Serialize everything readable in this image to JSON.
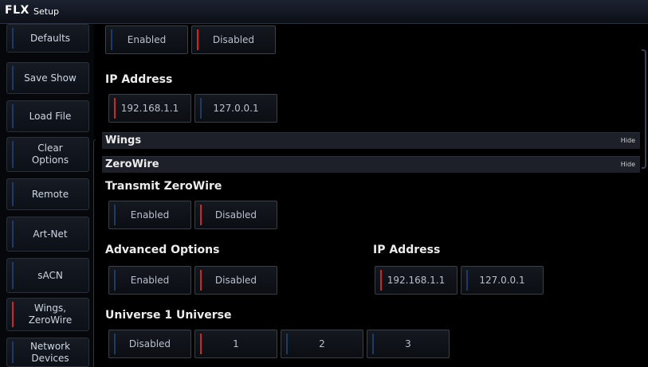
{
  "titlebar": {
    "logo": "FLX",
    "title": "Setup"
  },
  "sidebar": {
    "items": [
      {
        "label": "Defaults",
        "active": false
      },
      {
        "label": "Save Show",
        "active": false
      },
      {
        "label": "Load File",
        "active": false
      },
      {
        "label": "Clear Options",
        "active": false
      },
      {
        "label": "Remote",
        "active": false
      },
      {
        "label": "Art-Net",
        "active": false
      },
      {
        "label": "sACN",
        "active": false
      },
      {
        "label": "Wings, ZeroWire",
        "active": true
      },
      {
        "label": "Network Devices",
        "active": false
      }
    ]
  },
  "main": {
    "top_toggle": {
      "enabled": "Enabled",
      "disabled": "Disabled",
      "selected": "disabled"
    },
    "ip_address": {
      "label": "IP Address",
      "options": [
        "192.168.1.1",
        "127.0.0.1"
      ],
      "selected": "192.168.1.1"
    },
    "wings_header": {
      "title": "Wings",
      "hide": "Hide"
    },
    "zerowire_header": {
      "title": "ZeroWire",
      "hide": "Hide"
    },
    "transmit_zerowire": {
      "label": "Transmit ZeroWire",
      "enabled": "Enabled",
      "disabled": "Disabled",
      "selected": "disabled"
    },
    "advanced_options": {
      "label": "Advanced Options",
      "enabled": "Enabled",
      "disabled": "Disabled",
      "selected": "disabled"
    },
    "advanced_ip": {
      "label": "IP Address",
      "options": [
        "192.168.1.1",
        "127.0.0.1"
      ],
      "selected": "192.168.1.1"
    },
    "universe": {
      "label": "Universe 1 Universe",
      "options": [
        "Disabled",
        "1",
        "2",
        "3"
      ],
      "selected": "1"
    }
  },
  "colors": {
    "accent_red": "#d42323",
    "inactive_blue": "#1d3b66",
    "header_bg": "#1d2029"
  }
}
